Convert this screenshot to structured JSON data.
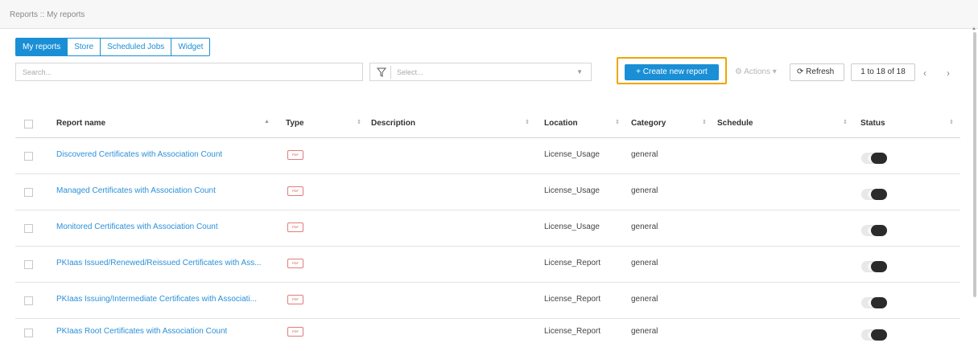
{
  "breadcrumb": "Reports :: My reports",
  "tabs": [
    {
      "label": "My reports",
      "active": true
    },
    {
      "label": "Store",
      "active": false
    },
    {
      "label": "Scheduled Jobs",
      "active": false
    },
    {
      "label": "Widget",
      "active": false
    }
  ],
  "search": {
    "placeholder": "Search..."
  },
  "filter": {
    "placeholder": "Select...",
    "icon": "filter-icon"
  },
  "toolbar": {
    "create_label": "+ Create new report",
    "actions_label": "Actions",
    "refresh_label": "Refresh",
    "pagination": "1 to 18 of 18",
    "prev_label": "‹",
    "next_label": "›"
  },
  "table": {
    "columns": [
      "Report name",
      "Type",
      "Description",
      "Location",
      "Category",
      "Schedule",
      "Status"
    ],
    "rows": [
      {
        "name": "Discovered Certificates with Association Count",
        "type": "PDF",
        "description": "",
        "location": "License_Usage",
        "category": "general",
        "schedule": ""
      },
      {
        "name": "Managed Certificates with Association Count",
        "type": "PDF",
        "description": "",
        "location": "License_Usage",
        "category": "general",
        "schedule": ""
      },
      {
        "name": "Monitored Certificates with Association Count",
        "type": "PDF",
        "description": "",
        "location": "License_Usage",
        "category": "general",
        "schedule": ""
      },
      {
        "name": "PKIaas Issued/Renewed/Reissued Certificates with Ass...",
        "type": "PDF",
        "description": "",
        "location": "License_Report",
        "category": "general",
        "schedule": ""
      },
      {
        "name": "PKIaas Issuing/Intermediate Certificates with Associati...",
        "type": "PDF",
        "description": "",
        "location": "License_Report",
        "category": "general",
        "schedule": ""
      },
      {
        "name": "PKIaas Root Certificates with Association Count",
        "type": "PDF",
        "description": "",
        "location": "License_Report",
        "category": "general",
        "schedule": ""
      }
    ]
  },
  "colors": {
    "accent": "#1a8fd6",
    "highlight": "#f0a500",
    "link": "#2b90d9"
  }
}
